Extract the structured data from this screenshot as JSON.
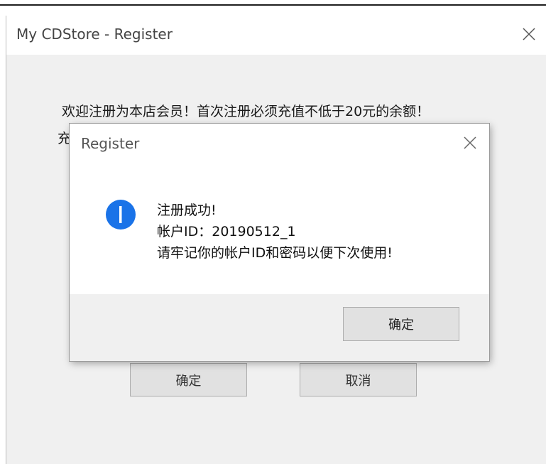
{
  "main_window": {
    "title": "My CDStore - Register",
    "close_icon": "close-icon",
    "welcome_text": "欢迎注册为本店会员！首次注册必须充值不低于20元的余额！",
    "second_line_visible": "充",
    "ok_label": "确定",
    "cancel_label": "取消"
  },
  "dialog": {
    "title": "Register",
    "close_icon": "close-icon",
    "icon": "info-icon",
    "message_lines": [
      "注册成功!",
      "帐户ID：20190512_1",
      "请牢记你的帐户ID和密码以便下次使用!"
    ],
    "ok_label": "确定"
  },
  "colors": {
    "info_icon_blue": "#1a73e8",
    "window_background": "#f0f0f0",
    "button_background": "#e1e1e1"
  }
}
